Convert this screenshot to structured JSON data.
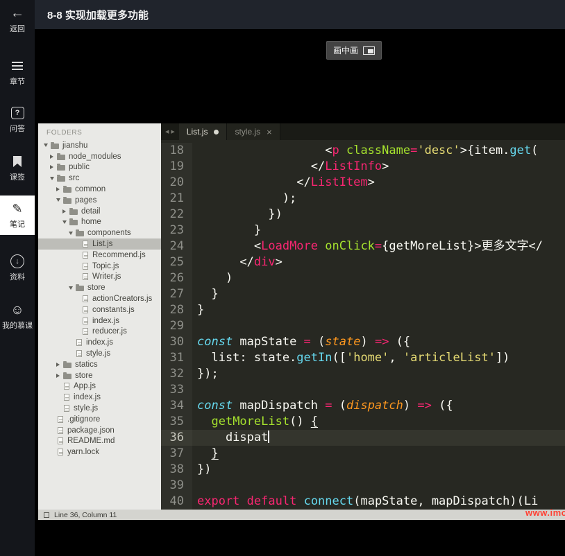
{
  "player": {
    "title": "8-8 实现加载更多功能",
    "pip_label": "画中画",
    "watermark": "www.imooc.com",
    "sidebar": [
      {
        "id": "back",
        "icon": "back-arrow-icon",
        "label": "返回",
        "active": false
      },
      {
        "id": "chapters",
        "icon": "menu-icon",
        "label": "章节",
        "active": false
      },
      {
        "id": "qa",
        "icon": "question-icon",
        "label": "问答",
        "active": false
      },
      {
        "id": "bookmark",
        "icon": "bookmark-icon",
        "label": "课签",
        "active": false
      },
      {
        "id": "notes",
        "icon": "pencil-icon",
        "label": "笔记",
        "active": true
      },
      {
        "id": "materials",
        "icon": "download-icon",
        "label": "资料",
        "active": false
      },
      {
        "id": "mooc",
        "icon": "avatar-icon",
        "label": "我的慕课",
        "active": false
      }
    ]
  },
  "editor": {
    "folders_label": "FOLDERS",
    "status": "Line 36, Column 11",
    "current_line": 36,
    "colors": {
      "background": "#272822",
      "pink": "#f92672",
      "green": "#a6e22e",
      "yellow": "#e6db74",
      "blue": "#66d9ef",
      "orange": "#fd971f",
      "plain": "#f8f8f2"
    },
    "tabs": [
      {
        "label": "List.js",
        "active": true,
        "modified": true
      },
      {
        "label": "style.js",
        "active": false,
        "modified": false
      }
    ],
    "tree": [
      {
        "name": "jianshu",
        "type": "folder",
        "depth": 0,
        "state": "expanded"
      },
      {
        "name": "node_modules",
        "type": "folder",
        "depth": 1,
        "state": "collapsed"
      },
      {
        "name": "public",
        "type": "folder",
        "depth": 1,
        "state": "collapsed"
      },
      {
        "name": "src",
        "type": "folder",
        "depth": 1,
        "state": "expanded"
      },
      {
        "name": "common",
        "type": "folder",
        "depth": 2,
        "state": "collapsed"
      },
      {
        "name": "pages",
        "type": "folder",
        "depth": 2,
        "state": "expanded"
      },
      {
        "name": "detail",
        "type": "folder",
        "depth": 3,
        "state": "collapsed"
      },
      {
        "name": "home",
        "type": "folder",
        "depth": 3,
        "state": "expanded"
      },
      {
        "name": "components",
        "type": "folder",
        "depth": 4,
        "state": "expanded"
      },
      {
        "name": "List.js",
        "type": "file",
        "depth": 5,
        "selected": true
      },
      {
        "name": "Recommend.js",
        "type": "file",
        "depth": 5
      },
      {
        "name": "Topic.js",
        "type": "file",
        "depth": 5
      },
      {
        "name": "Writer.js",
        "type": "file",
        "depth": 5
      },
      {
        "name": "store",
        "type": "folder",
        "depth": 4,
        "state": "expanded"
      },
      {
        "name": "actionCreators.js",
        "type": "file",
        "depth": 5
      },
      {
        "name": "constants.js",
        "type": "file",
        "depth": 5
      },
      {
        "name": "index.js",
        "type": "file",
        "depth": 5
      },
      {
        "name": "reducer.js",
        "type": "file",
        "depth": 5
      },
      {
        "name": "index.js",
        "type": "file",
        "depth": 4
      },
      {
        "name": "style.js",
        "type": "file",
        "depth": 4
      },
      {
        "name": "statics",
        "type": "folder",
        "depth": 2,
        "state": "collapsed"
      },
      {
        "name": "store",
        "type": "folder",
        "depth": 2,
        "state": "collapsed"
      },
      {
        "name": "App.js",
        "type": "file",
        "depth": 2
      },
      {
        "name": "index.js",
        "type": "file",
        "depth": 2
      },
      {
        "name": "style.js",
        "type": "file",
        "depth": 2
      },
      {
        "name": ".gitignore",
        "type": "file",
        "depth": 1
      },
      {
        "name": "package.json",
        "type": "file",
        "depth": 1
      },
      {
        "name": "README.md",
        "type": "file",
        "depth": 1
      },
      {
        "name": "yarn.lock",
        "type": "file",
        "depth": 1
      }
    ],
    "code": [
      {
        "n": 18,
        "segs": [
          [
            "w",
            "                  <"
          ],
          [
            "p",
            "p"
          ],
          [
            "w",
            " "
          ],
          [
            "g",
            "className"
          ],
          [
            "p",
            "="
          ],
          [
            "y",
            "'desc'"
          ],
          [
            "w",
            ">{item."
          ],
          [
            "b",
            "get"
          ],
          [
            "w",
            "("
          ]
        ]
      },
      {
        "n": 19,
        "segs": [
          [
            "w",
            "                </"
          ],
          [
            "p",
            "ListInfo"
          ],
          [
            "w",
            ">"
          ]
        ]
      },
      {
        "n": 20,
        "segs": [
          [
            "w",
            "              </"
          ],
          [
            "p",
            "ListItem"
          ],
          [
            "w",
            ">"
          ]
        ]
      },
      {
        "n": 21,
        "segs": [
          [
            "w",
            "            );"
          ]
        ]
      },
      {
        "n": 22,
        "segs": [
          [
            "w",
            "          })"
          ]
        ]
      },
      {
        "n": 23,
        "segs": [
          [
            "w",
            "        }"
          ]
        ]
      },
      {
        "n": 24,
        "segs": [
          [
            "w",
            "        <"
          ],
          [
            "p",
            "LoadMore"
          ],
          [
            "w",
            " "
          ],
          [
            "g",
            "onClick"
          ],
          [
            "p",
            "="
          ],
          [
            "w",
            "{getMoreList}>更多文字</"
          ]
        ]
      },
      {
        "n": 25,
        "segs": [
          [
            "w",
            "      </"
          ],
          [
            "p",
            "div"
          ],
          [
            "w",
            ">"
          ]
        ]
      },
      {
        "n": 26,
        "segs": [
          [
            "w",
            "    )"
          ]
        ]
      },
      {
        "n": 27,
        "segs": [
          [
            "w",
            "  }"
          ]
        ]
      },
      {
        "n": 28,
        "segs": [
          [
            "w",
            "}"
          ]
        ]
      },
      {
        "n": 29,
        "segs": []
      },
      {
        "n": 30,
        "segs": [
          [
            "bi",
            "const"
          ],
          [
            "w",
            " mapState "
          ],
          [
            "p",
            "="
          ],
          [
            "w",
            " ("
          ],
          [
            "oi",
            "state"
          ],
          [
            "w",
            ") "
          ],
          [
            "p",
            "=>"
          ],
          [
            "w",
            " ({"
          ]
        ]
      },
      {
        "n": 31,
        "segs": [
          [
            "w",
            "  list: state."
          ],
          [
            "b",
            "getIn"
          ],
          [
            "w",
            "(["
          ],
          [
            "y",
            "'home'"
          ],
          [
            "w",
            ", "
          ],
          [
            "y",
            "'articleList'"
          ],
          [
            "w",
            "])"
          ]
        ]
      },
      {
        "n": 32,
        "segs": [
          [
            "w",
            "});"
          ]
        ]
      },
      {
        "n": 33,
        "segs": []
      },
      {
        "n": 34,
        "segs": [
          [
            "bi",
            "const"
          ],
          [
            "w",
            " mapDispatch "
          ],
          [
            "p",
            "="
          ],
          [
            "w",
            " ("
          ],
          [
            "oi",
            "dispatch"
          ],
          [
            "w",
            ") "
          ],
          [
            "p",
            "=>"
          ],
          [
            "w",
            " ({"
          ]
        ]
      },
      {
        "n": 35,
        "segs": [
          [
            "w",
            "  "
          ],
          [
            "g",
            "getMoreList"
          ],
          [
            "w",
            "() "
          ],
          [
            "u",
            "{"
          ]
        ]
      },
      {
        "n": 36,
        "cursor": true,
        "segs": [
          [
            "w",
            "    dispat"
          ]
        ]
      },
      {
        "n": 37,
        "segs": [
          [
            "w",
            "  "
          ],
          [
            "u",
            "}"
          ]
        ]
      },
      {
        "n": 38,
        "segs": [
          [
            "w",
            "})"
          ]
        ]
      },
      {
        "n": 39,
        "segs": []
      },
      {
        "n": 40,
        "segs": [
          [
            "p",
            "export"
          ],
          [
            "w",
            " "
          ],
          [
            "p",
            "default"
          ],
          [
            "w",
            " "
          ],
          [
            "b",
            "connect"
          ],
          [
            "w",
            "(mapState, mapDispatch)(Li"
          ]
        ]
      }
    ]
  }
}
